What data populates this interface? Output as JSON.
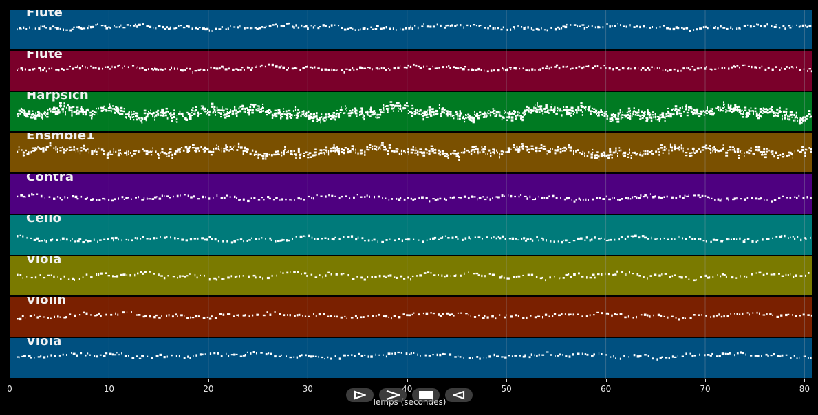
{
  "tracks": [
    {
      "name": "Flute",
      "color": "#005080",
      "center": 0.42,
      "spread": 0.1,
      "density": 1.0
    },
    {
      "name": "Flute",
      "color": "#7a002a",
      "center": 0.42,
      "spread": 0.1,
      "density": 1.0
    },
    {
      "name": "Harpsich",
      "color": "#007a22",
      "center": 0.5,
      "spread": 0.22,
      "density": 2.6
    },
    {
      "name": "Ensmble1",
      "color": "#7a5000",
      "center": 0.45,
      "spread": 0.16,
      "density": 1.6
    },
    {
      "name": "Contra",
      "color": "#4e0080",
      "center": 0.58,
      "spread": 0.1,
      "density": 0.9
    },
    {
      "name": "Cello",
      "color": "#007a7a",
      "center": 0.58,
      "spread": 0.1,
      "density": 0.9
    },
    {
      "name": "Viola",
      "color": "#7a7a00",
      "center": 0.47,
      "spread": 0.12,
      "density": 0.8
    },
    {
      "name": "Violin",
      "color": "#7a2000",
      "center": 0.45,
      "spread": 0.1,
      "density": 0.8
    },
    {
      "name": "Viola",
      "color": "#005080",
      "center": 0.42,
      "spread": 0.1,
      "density": 0.8
    }
  ],
  "x_axis": {
    "ticks": [
      0,
      10,
      20,
      30,
      40,
      50,
      60,
      70,
      80
    ],
    "range": [
      0,
      80.8
    ],
    "label": "Temps (secondes)"
  },
  "controls": [
    {
      "name": "play-icon",
      "label": "play"
    },
    {
      "name": "forward-icon",
      "label": "forward"
    },
    {
      "name": "stop-icon",
      "label": "stop"
    },
    {
      "name": "rewind-icon",
      "label": "rewind"
    }
  ],
  "colors": {
    "grid": "#9aa3ad",
    "note": "#ffffff",
    "background": "#000000"
  }
}
